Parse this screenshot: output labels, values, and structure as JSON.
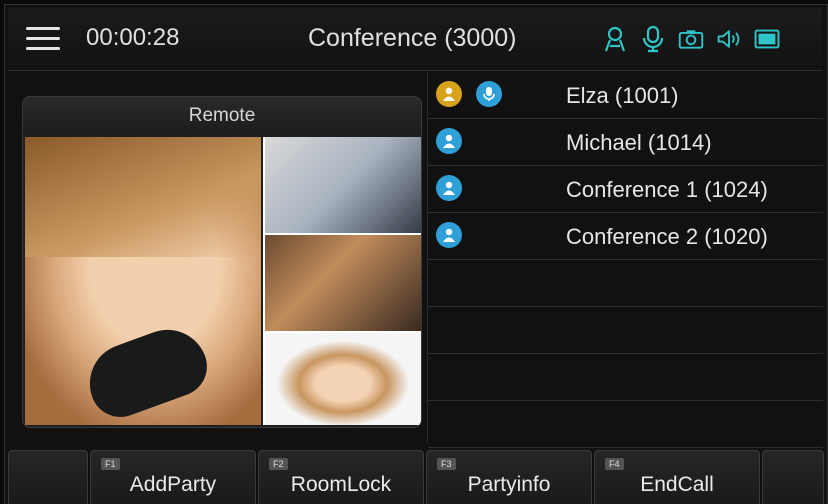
{
  "topbar": {
    "timer": "00:00:28",
    "title": "Conference (3000)",
    "status_icons": [
      "contacts-icon",
      "microphone-icon",
      "camera-icon",
      "speaker-icon",
      "screen-icon"
    ],
    "accent_color": "#2ec4c8"
  },
  "video": {
    "label": "Remote"
  },
  "participants": [
    {
      "name": "Elza (1001)",
      "badges": [
        "user-gold",
        "mic-blue"
      ]
    },
    {
      "name": "Michael (1014)",
      "badges": [
        "user-blue"
      ]
    },
    {
      "name": "Conference 1 (1024)",
      "badges": [
        "user-blue"
      ]
    },
    {
      "name": "Conference 2 (1020)",
      "badges": [
        "user-blue"
      ]
    }
  ],
  "softkeys": [
    {
      "key": "",
      "label": ""
    },
    {
      "key": "F1",
      "label": "AddParty"
    },
    {
      "key": "F2",
      "label": "RoomLock"
    },
    {
      "key": "F3",
      "label": "Partyinfo"
    },
    {
      "key": "F4",
      "label": "EndCall"
    },
    {
      "key": "",
      "label": ""
    }
  ]
}
